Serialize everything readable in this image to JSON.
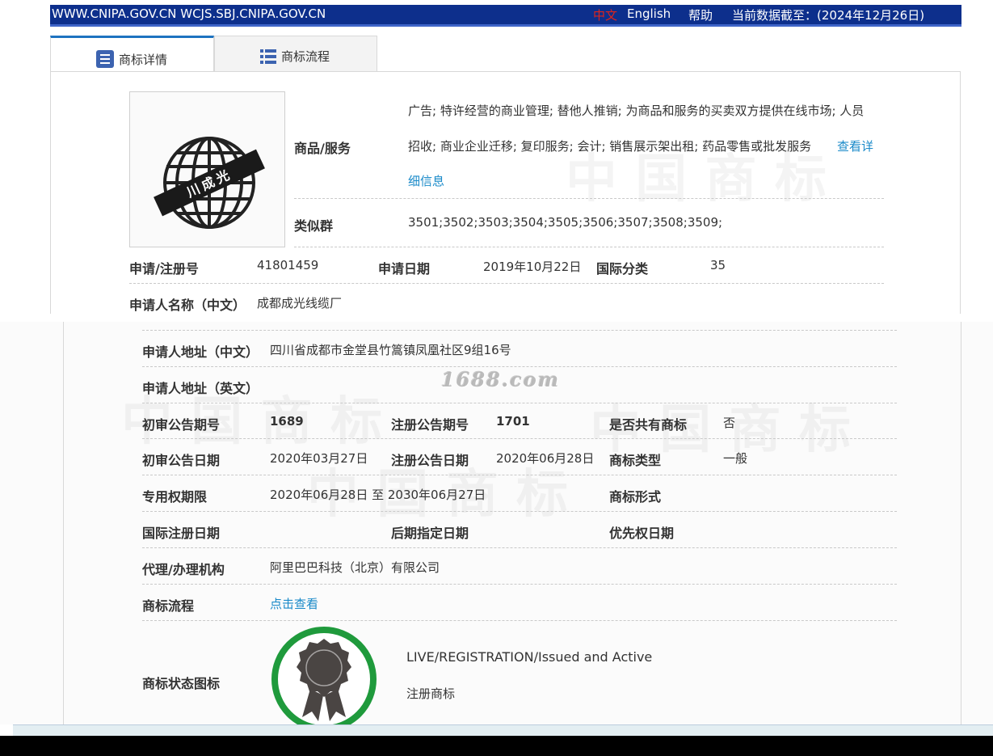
{
  "topbar": {
    "urls": "WWW.CNIPA.GOV.CN WCJS.SBJ.CNIPA.GOV.CN",
    "lang_cn": "中文",
    "lang_en": "English",
    "help": "帮助",
    "data_date": "当前数据截至：(2024年12月26日)"
  },
  "tabs": [
    {
      "label": "商标详情",
      "icon": "document-list-icon",
      "active": true
    },
    {
      "label": "商标流程",
      "icon": "table-list-icon",
      "active": false
    }
  ],
  "trademark_image": {
    "icon": "globe-trademark-icon",
    "band_text": "川成光"
  },
  "goods": {
    "label": "商品/服务",
    "line1": "广告; 特许经营的商业管理; 替他人推销; 为商品和服务的买卖双方提供在线市场; 人员",
    "line2": "招收; 商业企业迁移; 复印服务; 会计; 销售展示架出租; 药品零售或批发服务",
    "more_link_a": "查看详",
    "more_link_b": "细信息"
  },
  "similar_group": {
    "label": "类似群",
    "value": "3501;3502;3503;3504;3505;3506;3507;3508;3509;"
  },
  "reg_no": {
    "label": "申请/注册号",
    "value": "41801459"
  },
  "apply_date": {
    "label": "申请日期",
    "value": "2019年10月22日"
  },
  "intl_class": {
    "label": "国际分类",
    "value": "35"
  },
  "applicant_cn": {
    "label": "申请人名称（中文）",
    "value": "成都成光线缆厂"
  },
  "address_cn": {
    "label": "申请人地址（中文）",
    "value": "四川省成都市金堂县竹篙镇凤凰社区9组16号"
  },
  "address_en": {
    "label": "申请人地址（英文）",
    "value": ""
  },
  "prelim_no": {
    "label": "初审公告期号",
    "value": "1689"
  },
  "reg_notice_no": {
    "label": "注册公告期号",
    "value": "1701"
  },
  "shared": {
    "label": "是否共有商标",
    "value": "否"
  },
  "prelim_date": {
    "label": "初审公告日期",
    "value": "2020年03月27日"
  },
  "reg_notice_date": {
    "label": "注册公告日期",
    "value": "2020年06月28日"
  },
  "tm_type": {
    "label": "商标类型",
    "value": "一般"
  },
  "exclusive": {
    "label": "专用权期限",
    "value": "2020年06月28日 至 2030年06月27日"
  },
  "tm_form": {
    "label": "商标形式",
    "value": ""
  },
  "intl_reg_date": {
    "label": "国际注册日期",
    "value": ""
  },
  "later_date": {
    "label": "后期指定日期",
    "value": ""
  },
  "priority_date": {
    "label": "优先权日期",
    "value": ""
  },
  "agent": {
    "label": "代理/办理机构",
    "value": "阿里巴巴科技（北京）有限公司"
  },
  "process": {
    "label": "商标流程",
    "link": "点击查看"
  },
  "status": {
    "label": "商标状态图标",
    "icon": "registered-badge-icon",
    "line1": "LIVE/REGISTRATION/Issued and Active",
    "line2": "注册商标"
  },
  "watermark": "1688.com",
  "colors": {
    "topbar": "#0d2f8c",
    "link": "#1a8ac9",
    "badge_ring": "#1f9a3c",
    "badge_body": "#4a4543"
  }
}
